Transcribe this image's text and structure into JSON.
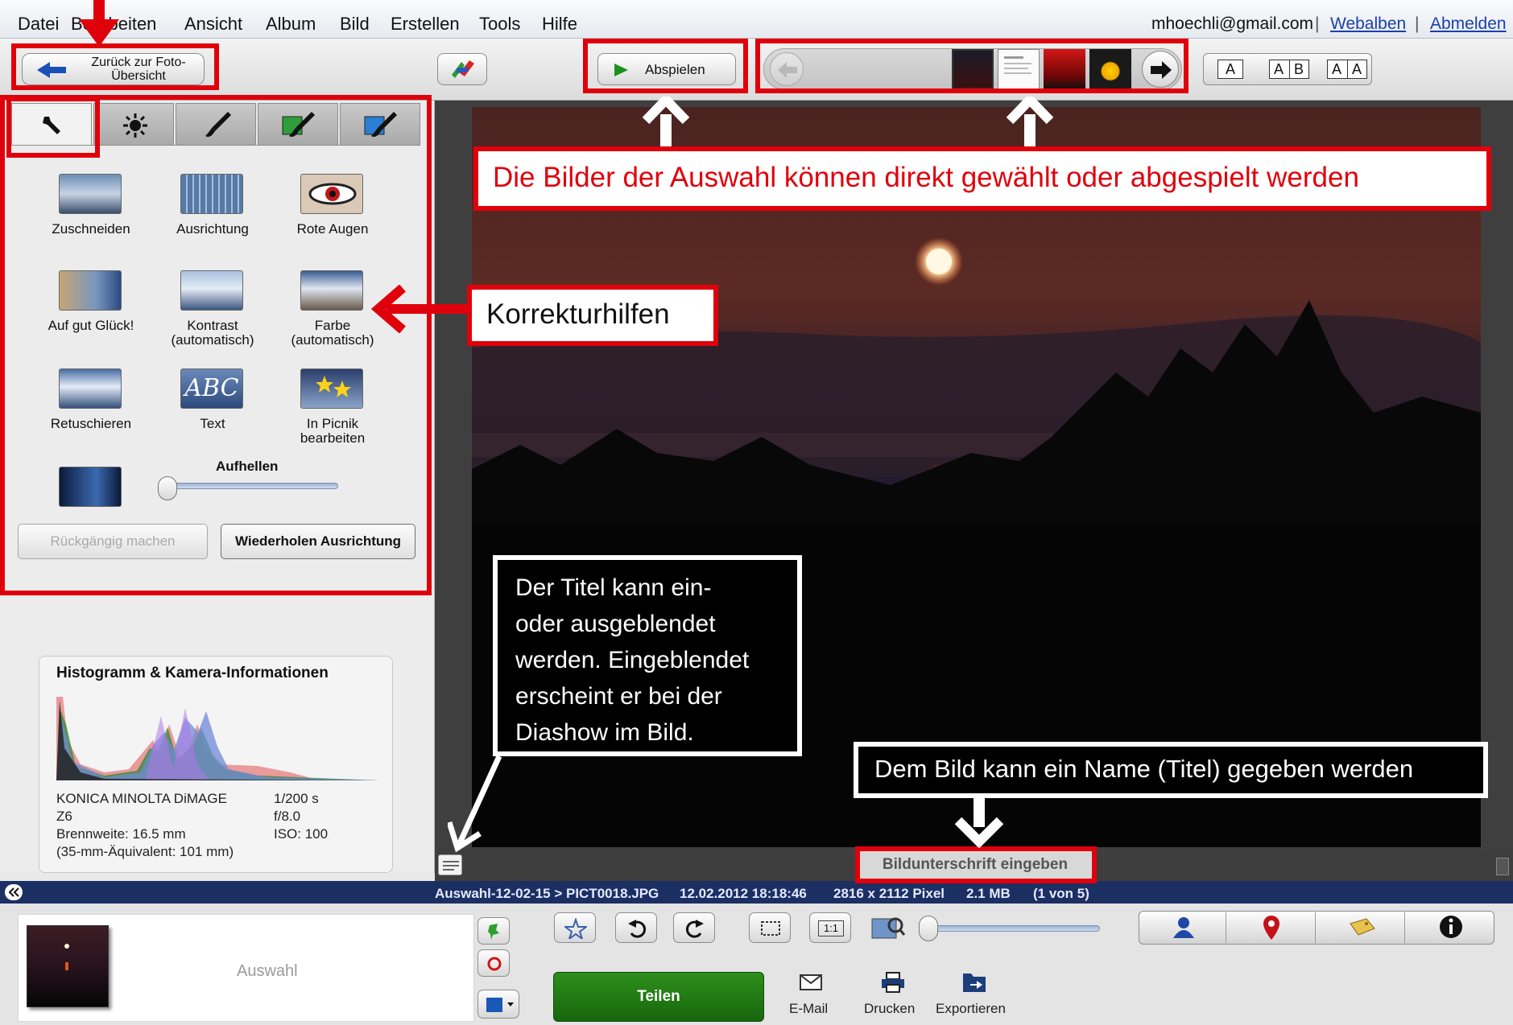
{
  "menu": {
    "items": [
      "Datei",
      "Bearbeiten",
      "Ansicht",
      "Album",
      "Bild",
      "Erstellen",
      "Tools",
      "Hilfe"
    ],
    "account_email": "mhoechli@gmail.com",
    "separator": "|",
    "web_albums": "Webalben",
    "logout": "Abmelden"
  },
  "toolbar": {
    "back_label_line1": "Zurück zur Foto-",
    "back_label_line2": "Übersicht",
    "play_label": "Abspielen",
    "view_a": "A",
    "view_ab_1": "A",
    "view_ab_2": "B",
    "view_aa_1": "A",
    "view_aa_2": "A"
  },
  "left_panel": {
    "tools": [
      {
        "label": "Zuschneiden"
      },
      {
        "label": "Ausrichtung"
      },
      {
        "label": "Rote Augen"
      },
      {
        "label": "Auf gut Glück!"
      },
      {
        "label_line1": "Kontrast",
        "label_line2": "(automatisch)"
      },
      {
        "label_line1": "Farbe",
        "label_line2": "(automatisch)"
      },
      {
        "label": "Retuschieren"
      },
      {
        "label": "Text",
        "thumb_text": "ABC"
      },
      {
        "label_line1": "In Picnik",
        "label_line2": "bearbeiten"
      }
    ],
    "brighten_label": "Aufhellen",
    "undo_label": "Rückgängig machen",
    "redo_label": "Wiederholen Ausrichtung",
    "histogram_title": "Histogramm & Kamera-Informationen",
    "camera_line1": "KONICA MINOLTA  DiMAGE",
    "camera_line2": "Z6",
    "focal_length": "Brennweite: 16.5 mm",
    "equivalent": "(35-mm-Äquivalent: 101 mm)",
    "shutter": "1/200 s",
    "aperture": "f/8.0",
    "iso": "ISO: 100"
  },
  "viewer": {
    "caption_placeholder": "Bildunterschrift eingeben"
  },
  "status_bar": {
    "path": "Auswahl-12-02-15 > PICT0018.JPG",
    "datetime": "12.02.2012 18:18:46",
    "dimensions": "2816 x 2112 Pixel",
    "size": "2.1 MB",
    "position": "(1 von 5)"
  },
  "tray": {
    "selection_label": "Auswahl",
    "share_label": "Teilen",
    "email_label": "E-Mail",
    "print_label": "Drucken",
    "export_label": "Exportieren",
    "zoom_1to1": "1:1"
  },
  "annotations": {
    "selection_note": "Die Bilder der Auswahl können direkt gewählt oder abgespielt werden",
    "correction_note": "Korrekturhilfen",
    "title_note_l1": "Der Titel kann ein-",
    "title_note_l2": "oder ausgeblendet",
    "title_note_l3": "werden. Eingeblendet",
    "title_note_l4": "erscheint er bei der",
    "title_note_l5": "Diashow im Bild.",
    "name_note": "Dem Bild kann ein Name (Titel) gegeben werden"
  },
  "colors": {
    "annotation_red": "#e0000b",
    "share_green": "#1f7a12",
    "status_navy": "#1b2f63",
    "link_blue": "#1a3fae"
  }
}
